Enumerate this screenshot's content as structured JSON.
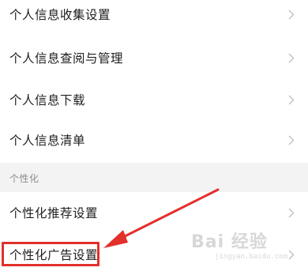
{
  "settings": {
    "rows_top": [
      {
        "label": "个人信息收集设置"
      },
      {
        "label": "个人信息查阅与管理"
      },
      {
        "label": "个人信息下载"
      },
      {
        "label": "个人信息清单"
      }
    ],
    "section_title": "个性化",
    "rows_bottom": [
      {
        "label": "个性化推荐设置"
      },
      {
        "label": "个性化广告设置"
      }
    ]
  },
  "annotation": {
    "color": "#e2302a",
    "target": "个性化广告设置"
  },
  "watermark": {
    "brand": "Bai 经验",
    "url": "jingyan.baidu.com"
  },
  "icons": {
    "chevron": "chevron-right-icon"
  }
}
